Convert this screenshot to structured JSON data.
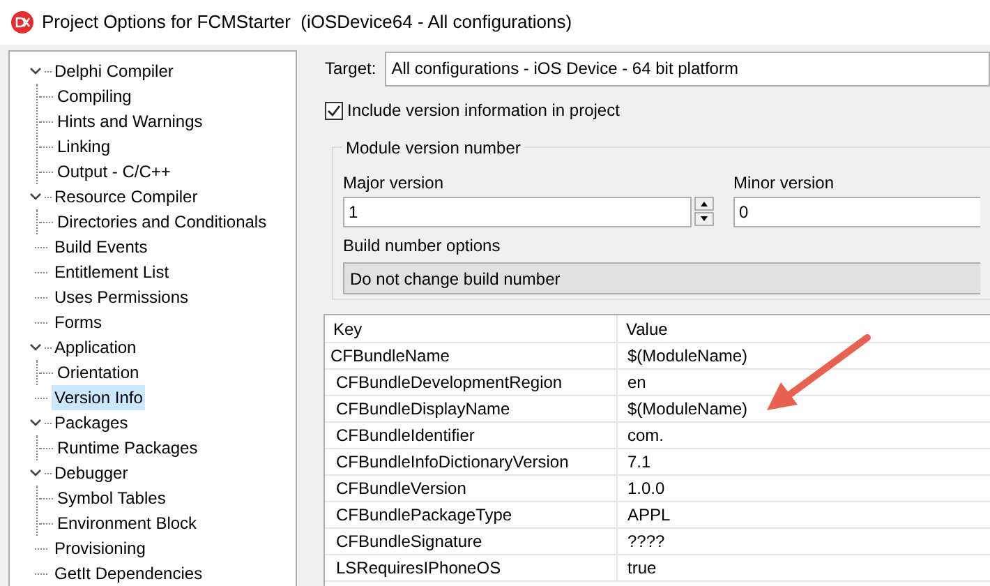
{
  "window": {
    "title": "Project Options for FCMStarter  (iOSDevice64 - All configurations)"
  },
  "tree": [
    {
      "label": "Delphi Compiler",
      "expanded": true,
      "selected": false,
      "children": [
        {
          "label": "Compiling",
          "selected": false
        },
        {
          "label": "Hints and Warnings",
          "selected": false
        },
        {
          "label": "Linking",
          "selected": false
        },
        {
          "label": "Output - C/C++",
          "selected": false
        }
      ]
    },
    {
      "label": "Resource Compiler",
      "expanded": true,
      "selected": false,
      "children": [
        {
          "label": "Directories and Conditionals",
          "selected": false
        }
      ]
    },
    {
      "label": "Build Events",
      "selected": false
    },
    {
      "label": "Entitlement List",
      "selected": false
    },
    {
      "label": "Uses Permissions",
      "selected": false
    },
    {
      "label": "Forms",
      "selected": false
    },
    {
      "label": "Application",
      "expanded": true,
      "selected": false,
      "children": [
        {
          "label": "Orientation",
          "selected": false
        }
      ]
    },
    {
      "label": "Version Info",
      "selected": true
    },
    {
      "label": "Packages",
      "expanded": true,
      "selected": false,
      "children": [
        {
          "label": "Runtime Packages",
          "selected": false
        }
      ]
    },
    {
      "label": "Debugger",
      "expanded": true,
      "selected": false,
      "children": [
        {
          "label": "Symbol Tables",
          "selected": false
        },
        {
          "label": "Environment Block",
          "selected": false
        }
      ]
    },
    {
      "label": "Provisioning",
      "selected": false
    },
    {
      "label": "GetIt Dependencies",
      "selected": false
    }
  ],
  "target": {
    "label": "Target:",
    "value": "All configurations - iOS Device - 64 bit platform"
  },
  "include_version": {
    "label": "Include version information in project",
    "checked": true
  },
  "module_version": {
    "title": "Module version number",
    "major": {
      "label": "Major version",
      "value": "1"
    },
    "minor": {
      "label": "Minor version",
      "value": "0"
    },
    "build_options": {
      "label": "Build number options",
      "value": "Do not change build number"
    }
  },
  "table": {
    "columns": [
      "Key",
      "Value"
    ],
    "rows": [
      [
        "CFBundleName",
        "$(ModuleName)"
      ],
      [
        "CFBundleDevelopmentRegion",
        "en"
      ],
      [
        "CFBundleDisplayName",
        "$(ModuleName)"
      ],
      [
        "CFBundleIdentifier",
        "com."
      ],
      [
        "CFBundleInfoDictionaryVersion",
        "7.1"
      ],
      [
        "CFBundleVersion",
        "1.0.0"
      ],
      [
        "CFBundlePackageType",
        "APPL"
      ],
      [
        "CFBundleSignature",
        "????"
      ],
      [
        "LSRequiresIPhoneOS",
        "true"
      ]
    ]
  }
}
